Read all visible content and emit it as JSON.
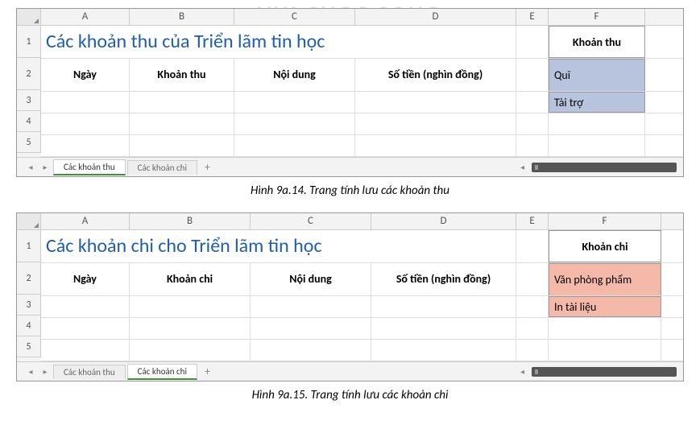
{
  "watermark": "VUI CUOC SONG",
  "columns": [
    "A",
    "B",
    "C",
    "D",
    "E",
    "F"
  ],
  "rows": [
    "1",
    "2",
    "3",
    "4",
    "5"
  ],
  "sheet1": {
    "title": "Các khoản thu của Triển lãm tin học",
    "headers": {
      "A": "Ngày",
      "B": "Khoản thu",
      "C": "Nội dung",
      "D": "Số tiền (nghìn đồng)"
    },
    "side_header": "Khoản thu",
    "side_items": [
      "Quĩ",
      "Tài trợ"
    ],
    "tabs": {
      "active": "Các khoản thu",
      "inactive": "Các khoản chi"
    },
    "caption": "Hình 9a.14. Trang tính lưu các khoản thu"
  },
  "sheet2": {
    "title": "Các khoản chi cho Triển lãm tin học",
    "headers": {
      "A": "Ngày",
      "B": "Khoản chi",
      "C": "Nội dung",
      "D": "Số tiền (nghìn đồng)"
    },
    "side_header": "Khoản chi",
    "side_items": [
      "Văn phòng phẩm",
      "In tài liệu"
    ],
    "tabs": {
      "inactive": "Các khoản thu",
      "active": "Các khoản chi"
    },
    "caption": "Hình 9a.15. Trang tính lưu các khoản chi"
  },
  "chart_data": {
    "type": "table",
    "sheets": [
      {
        "name": "Các khoản thu",
        "title": "Các khoản thu của Triển lãm tin học",
        "columns": [
          "Ngày",
          "Khoản thu",
          "Nội dung",
          "Số tiền (nghìn đồng)"
        ],
        "lookup": {
          "header": "Khoản thu",
          "values": [
            "Quĩ",
            "Tài trợ"
          ]
        }
      },
      {
        "name": "Các khoản chi",
        "title": "Các khoản chi cho Triển lãm tin học",
        "columns": [
          "Ngày",
          "Khoản chi",
          "Nội dung",
          "Số tiền (nghìn đồng)"
        ],
        "lookup": {
          "header": "Khoản chi",
          "values": [
            "Văn phòng phẩm",
            "In tài liệu"
          ]
        }
      }
    ]
  }
}
